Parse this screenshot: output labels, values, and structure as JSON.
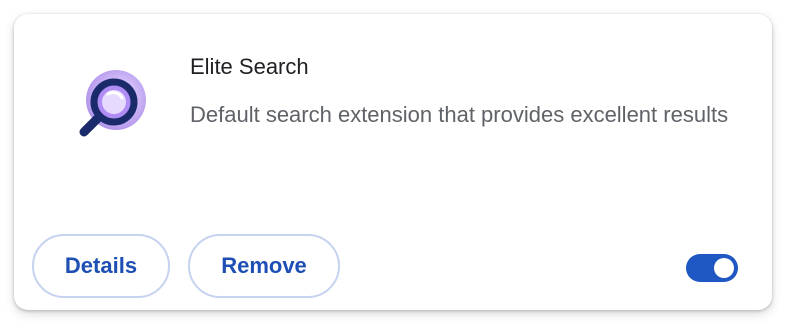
{
  "extension": {
    "name": "Elite Search",
    "description": "Default search extension that provides excellent results",
    "icon": "magnifier-icon",
    "enabled": true
  },
  "buttons": {
    "details_label": "Details",
    "remove_label": "Remove"
  },
  "colors": {
    "accent": "#1f57c3",
    "button_text": "#1e4fb5",
    "button_border": "#c6d2f0",
    "icon_purple": "#6b35d6"
  }
}
